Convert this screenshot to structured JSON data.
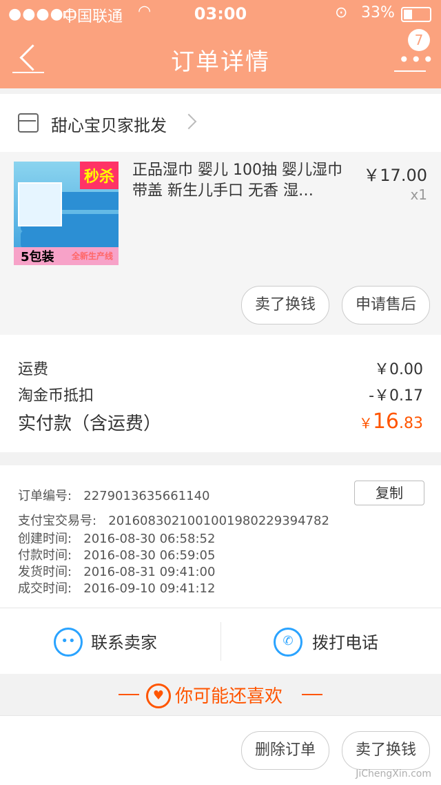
{
  "status_bar": {
    "signal": "●●●●○",
    "carrier": "中国联通",
    "time": "03:00",
    "battery_percent": "33%",
    "battery_level": 0.33
  },
  "header": {
    "title": "订单详情",
    "badge_count": "7"
  },
  "shop": {
    "name": "甜心宝贝家批发"
  },
  "item": {
    "description": "正品湿巾 婴儿 100抽 婴儿湿巾带盖 新生儿手口 无香 湿…",
    "price": "￥17.00",
    "quantity": "x1",
    "thumb_promo": "秒杀",
    "thumb_text1": "5包装",
    "thumb_text2": "全新生产线",
    "actions": [
      "卖了换钱",
      "申请售后"
    ]
  },
  "cost": {
    "shipping_label": "运费",
    "shipping_value": "￥0.00",
    "coin_label": "淘金币抵扣",
    "coin_value": "-￥0.17",
    "total_label": "实付款（含运费）",
    "total_currency": "￥",
    "total_int": "16",
    "total_dec": ".83"
  },
  "order_info": {
    "order_no_label": "订单编号:",
    "order_no": "2279013635661140",
    "copy_label": "复制",
    "alipay_label": "支付宝交易号:",
    "alipay_no": "2016083021001001980229394782",
    "created_label": "创建时间:",
    "created": "2016-08-30 06:58:52",
    "paid_label": "付款时间:",
    "paid": "2016-08-30 06:59:05",
    "shipped_label": "发货时间:",
    "shipped": "2016-08-31 09:41:00",
    "done_label": "成交时间:",
    "done": "2016-09-10 09:41:12"
  },
  "contact": {
    "seller": "联系卖家",
    "call": "拨打电话"
  },
  "recommend": {
    "title": "你可能还喜欢"
  },
  "bottom_actions": [
    "删除订单",
    "卖了换钱"
  ],
  "watermark": "JiChengXin.com",
  "colors": {
    "header_bg": "#fba27e",
    "accent_orange": "#ff5500",
    "icon_blue": "#2aa3ff"
  }
}
